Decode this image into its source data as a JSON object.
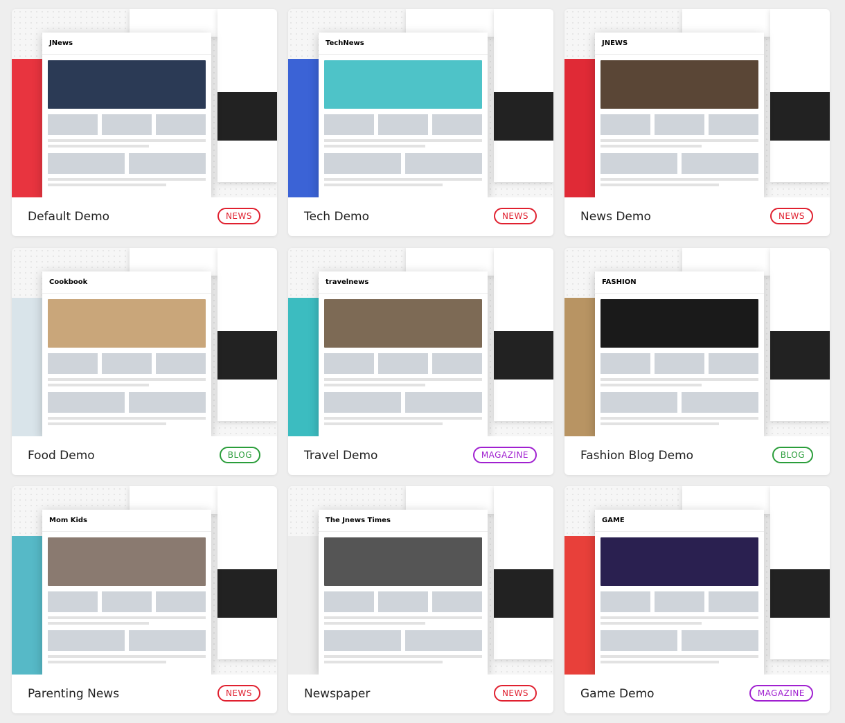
{
  "colors": {
    "news": "#e0202f",
    "blog": "#2a9d3a",
    "magazine": "#a020d0"
  },
  "demos": [
    {
      "name": "Default Demo",
      "badge": "NEWS",
      "type": "news",
      "accent": "#e8343f",
      "logo": "JNews",
      "hero": "#2b3a55"
    },
    {
      "name": "Tech Demo",
      "badge": "NEWS",
      "type": "news",
      "accent": "#3b63d6",
      "logo": "TechNews",
      "hero": "#4ec3c8"
    },
    {
      "name": "News Demo",
      "badge": "NEWS",
      "type": "news",
      "accent": "#e02a36",
      "logo": "JNEWS",
      "hero": "#5a4636"
    },
    {
      "name": "Food Demo",
      "badge": "BLOG",
      "type": "blog",
      "accent": "#d9e4ea",
      "logo": "Cookbook",
      "hero": "#c9a67a"
    },
    {
      "name": "Travel Demo",
      "badge": "MAGAZINE",
      "type": "magazine",
      "accent": "#3cbcc0",
      "logo": "travelnews",
      "hero": "#7d6a55"
    },
    {
      "name": "Fashion Blog Demo",
      "badge": "BLOG",
      "type": "blog",
      "accent": "#b89463",
      "logo": "FASHION",
      "hero": "#1a1a1a"
    },
    {
      "name": "Parenting News",
      "badge": "NEWS",
      "type": "news",
      "accent": "#56b9c7",
      "logo": "Mom Kids",
      "hero": "#8a7a70"
    },
    {
      "name": "Newspaper",
      "badge": "NEWS",
      "type": "news",
      "accent": "#ececec",
      "logo": "The Jnews Times",
      "hero": "#555555"
    },
    {
      "name": "Game Demo",
      "badge": "MAGAZINE",
      "type": "magazine",
      "accent": "#e8403a",
      "logo": "GAME",
      "hero": "#2a2050"
    }
  ]
}
